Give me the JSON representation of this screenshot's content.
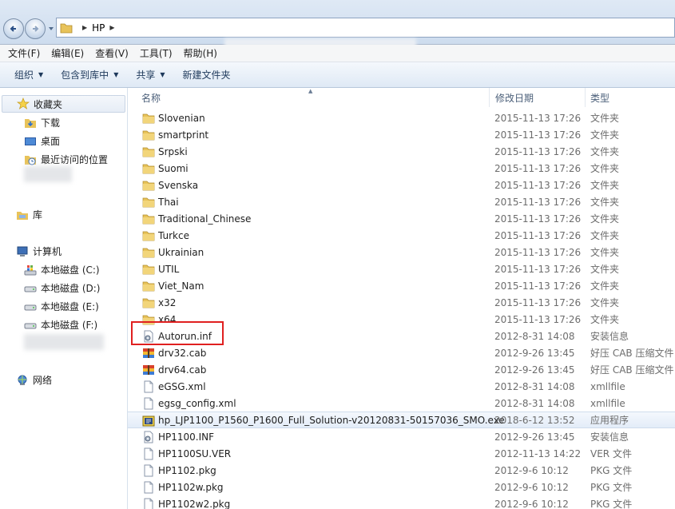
{
  "address": {
    "crumbs": [
      "HP"
    ]
  },
  "menu": [
    "文件(F)",
    "编辑(E)",
    "查看(V)",
    "工具(T)",
    "帮助(H)"
  ],
  "commands": [
    {
      "label": "组织",
      "dropdown": true
    },
    {
      "label": "包含到库中",
      "dropdown": true
    },
    {
      "label": "共享",
      "dropdown": true
    },
    {
      "label": "新建文件夹",
      "dropdown": false
    }
  ],
  "nav": {
    "favorites": "收藏夹",
    "fav_items": [
      "下载",
      "桌面",
      "最近访问的位置"
    ],
    "libraries": "库",
    "computer": "计算机",
    "drives": [
      "本地磁盘 (C:)",
      "本地磁盘 (D:)",
      "本地磁盘 (E:)",
      "本地磁盘 (F:)"
    ],
    "network": "网络"
  },
  "columns": {
    "name": "名称",
    "date": "修改日期",
    "type": "类型"
  },
  "files": [
    {
      "name": "Slovenian",
      "date": "2015-11-13 17:26",
      "type": "文件夹",
      "icon": "folder"
    },
    {
      "name": "smartprint",
      "date": "2015-11-13 17:26",
      "type": "文件夹",
      "icon": "folder"
    },
    {
      "name": "Srpski",
      "date": "2015-11-13 17:26",
      "type": "文件夹",
      "icon": "folder"
    },
    {
      "name": "Suomi",
      "date": "2015-11-13 17:26",
      "type": "文件夹",
      "icon": "folder"
    },
    {
      "name": "Svenska",
      "date": "2015-11-13 17:26",
      "type": "文件夹",
      "icon": "folder"
    },
    {
      "name": "Thai",
      "date": "2015-11-13 17:26",
      "type": "文件夹",
      "icon": "folder"
    },
    {
      "name": "Traditional_Chinese",
      "date": "2015-11-13 17:26",
      "type": "文件夹",
      "icon": "folder"
    },
    {
      "name": "Turkce",
      "date": "2015-11-13 17:26",
      "type": "文件夹",
      "icon": "folder"
    },
    {
      "name": "Ukrainian",
      "date": "2015-11-13 17:26",
      "type": "文件夹",
      "icon": "folder"
    },
    {
      "name": "UTIL",
      "date": "2015-11-13 17:26",
      "type": "文件夹",
      "icon": "folder"
    },
    {
      "name": "Viet_Nam",
      "date": "2015-11-13 17:26",
      "type": "文件夹",
      "icon": "folder"
    },
    {
      "name": "x32",
      "date": "2015-11-13 17:26",
      "type": "文件夹",
      "icon": "folder"
    },
    {
      "name": "x64",
      "date": "2015-11-13 17:26",
      "type": "文件夹",
      "icon": "folder"
    },
    {
      "name": "Autorun.inf",
      "date": "2012-8-31 14:08",
      "type": "安装信息",
      "icon": "inf"
    },
    {
      "name": "drv32.cab",
      "date": "2012-9-26 13:45",
      "type": "好压 CAB 压缩文件",
      "icon": "cab"
    },
    {
      "name": "drv64.cab",
      "date": "2012-9-26 13:45",
      "type": "好压 CAB 压缩文件",
      "icon": "cab"
    },
    {
      "name": "eGSG.xml",
      "date": "2012-8-31 14:08",
      "type": "xmllfile",
      "icon": "doc"
    },
    {
      "name": "egsg_config.xml",
      "date": "2012-8-31 14:08",
      "type": "xmllfile",
      "icon": "doc"
    },
    {
      "name": "hp_LJP1100_P1560_P1600_Full_Solution-v20120831-50157036_SMO.exe",
      "date": "2018-6-12 13:52",
      "type": "应用程序",
      "icon": "exe"
    },
    {
      "name": "HP1100.INF",
      "date": "2012-9-26 13:45",
      "type": "安装信息",
      "icon": "inf"
    },
    {
      "name": "HP1100SU.VER",
      "date": "2012-11-13 14:22",
      "type": "VER 文件",
      "icon": "doc"
    },
    {
      "name": "HP1102.pkg",
      "date": "2012-9-6 10:12",
      "type": "PKG 文件",
      "icon": "doc"
    },
    {
      "name": "HP1102w.pkg",
      "date": "2012-9-6 10:12",
      "type": "PKG 文件",
      "icon": "doc"
    },
    {
      "name": "HP1102w2.pkg",
      "date": "2012-9-6 10:12",
      "type": "PKG 文件",
      "icon": "doc"
    }
  ],
  "selected_row": 18,
  "highlighted_file": "Autorun.inf",
  "colors": {
    "highlight": "#e02020",
    "folder": "#e8c35a"
  }
}
